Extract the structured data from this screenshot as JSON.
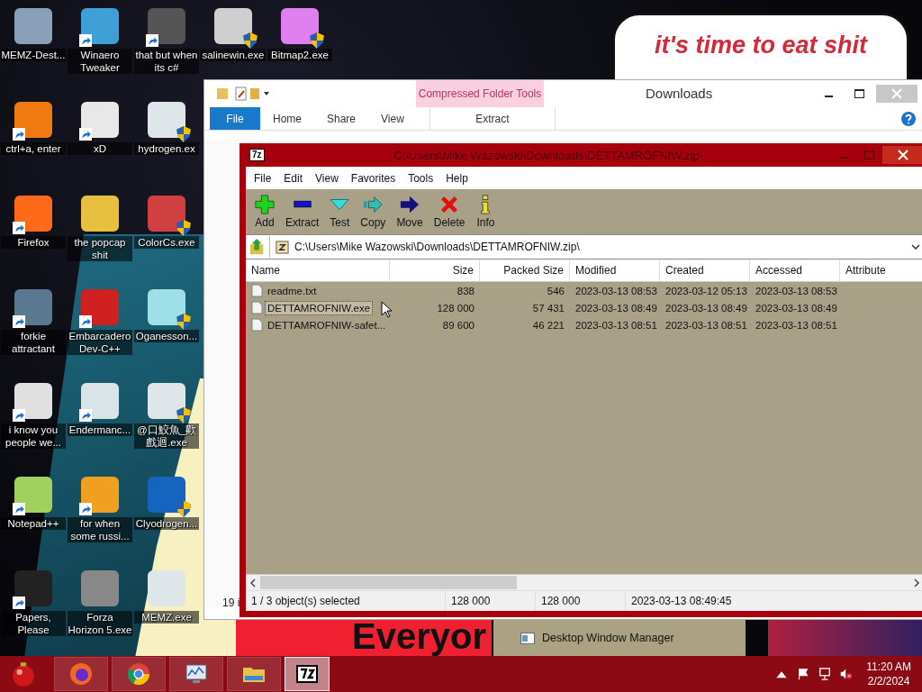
{
  "wallpaper": {
    "bubble_text": "it's time to eat shit",
    "banner_text": "Everyor"
  },
  "desktop_icons": [
    {
      "label": "MEMZ-Dest...",
      "shortcut": false,
      "shield": false
    },
    {
      "label": "ctrl+a, enter",
      "shortcut": true,
      "shield": false
    },
    {
      "label": "Firefox",
      "shortcut": true,
      "shield": false
    },
    {
      "label": "forkie attractant",
      "shortcut": true,
      "shield": false
    },
    {
      "label": "i know you people we...",
      "shortcut": true,
      "shield": false
    },
    {
      "label": "Notepad++",
      "shortcut": true,
      "shield": false
    },
    {
      "label": "Papers, Please",
      "shortcut": true,
      "shield": false
    },
    {
      "label": "Winaero Tweaker",
      "shortcut": true,
      "shield": false
    },
    {
      "label": "xD",
      "shortcut": true,
      "shield": false
    },
    {
      "label": "the popcap shit",
      "shortcut": false,
      "shield": false
    },
    {
      "label": "Embarcadero Dev-C++",
      "shortcut": true,
      "shield": false
    },
    {
      "label": "Endermanc...",
      "shortcut": true,
      "shield": false
    },
    {
      "label": "for when some russi...",
      "shortcut": true,
      "shield": false
    },
    {
      "label": "Forza Horizon 5.exe",
      "shortcut": false,
      "shield": false
    },
    {
      "label": "that but when its c#",
      "shortcut": true,
      "shield": false
    },
    {
      "label": "hydrogen.ex",
      "shortcut": false,
      "shield": true
    },
    {
      "label": "ColorCs.exe",
      "shortcut": false,
      "shield": true
    },
    {
      "label": "Oganesson...",
      "shortcut": false,
      "shield": true
    },
    {
      "label": "@口鮫魚_歡戲迴.exe",
      "shortcut": false,
      "shield": true
    },
    {
      "label": "Clyodrogen...",
      "shortcut": false,
      "shield": true
    },
    {
      "label": "MEMZ.exe",
      "shortcut": false,
      "shield": false
    },
    {
      "label": "salinewin.exe",
      "shortcut": false,
      "shield": true
    },
    {
      "label": "Bitmap2.exe",
      "shortcut": false,
      "shield": true
    }
  ],
  "explorer": {
    "context_tab": "Compressed Folder Tools",
    "title": "Downloads",
    "ribbon_tabs": [
      {
        "label": "File",
        "selected": true
      },
      {
        "label": "Home",
        "selected": false
      },
      {
        "label": "Share",
        "selected": false
      },
      {
        "label": "View",
        "selected": false
      },
      {
        "label": "Extract",
        "selected": false
      }
    ],
    "status": "19 i"
  },
  "sevenzip": {
    "app_logo": "7z",
    "title": "C:\\Users\\Mike Wazowski\\Downloads\\DETTAMROFNIW.zip\\",
    "menu": [
      "File",
      "Edit",
      "View",
      "Favorites",
      "Tools",
      "Help"
    ],
    "toolbar": [
      "Add",
      "Extract",
      "Test",
      "Copy",
      "Move",
      "Delete",
      "Info"
    ],
    "path": "C:\\Users\\Mike Wazowski\\Downloads\\DETTAMROFNIW.zip\\",
    "columns": [
      "Name",
      "Size",
      "Packed Size",
      "Modified",
      "Created",
      "Accessed",
      "Attribute"
    ],
    "rows": [
      {
        "name": "readme.txt",
        "size": "838",
        "packed_size": "546",
        "modified": "2023-03-13 08:53",
        "created": "2023-03-12 05:13",
        "accessed": "2023-03-13 08:53",
        "selected": false
      },
      {
        "name": "DETTAMROFNIW.exe",
        "size": "128 000",
        "packed_size": "57 431",
        "modified": "2023-03-13 08:49",
        "created": "2023-03-13 08:49",
        "accessed": "2023-03-13 08:49",
        "selected": true
      },
      {
        "name": "DETTAMROFNIW-safet...",
        "size": "89 600",
        "packed_size": "46 221",
        "modified": "2023-03-13 08:51",
        "created": "2023-03-13 08:51",
        "accessed": "2023-03-13 08:51",
        "selected": false
      }
    ],
    "status_bar": [
      "1 / 3 object(s) selected",
      "128 000",
      "128 000",
      "2023-03-13 08:49:45"
    ]
  },
  "popup": {
    "items": [
      "Desktop Window Manager"
    ]
  },
  "taskbar": {
    "apps": [
      {
        "active": false
      },
      {
        "active": false
      },
      {
        "active": false
      },
      {
        "active": false
      },
      {
        "active": true
      }
    ],
    "time": "11:20 AM",
    "date": "2/2/2024"
  }
}
